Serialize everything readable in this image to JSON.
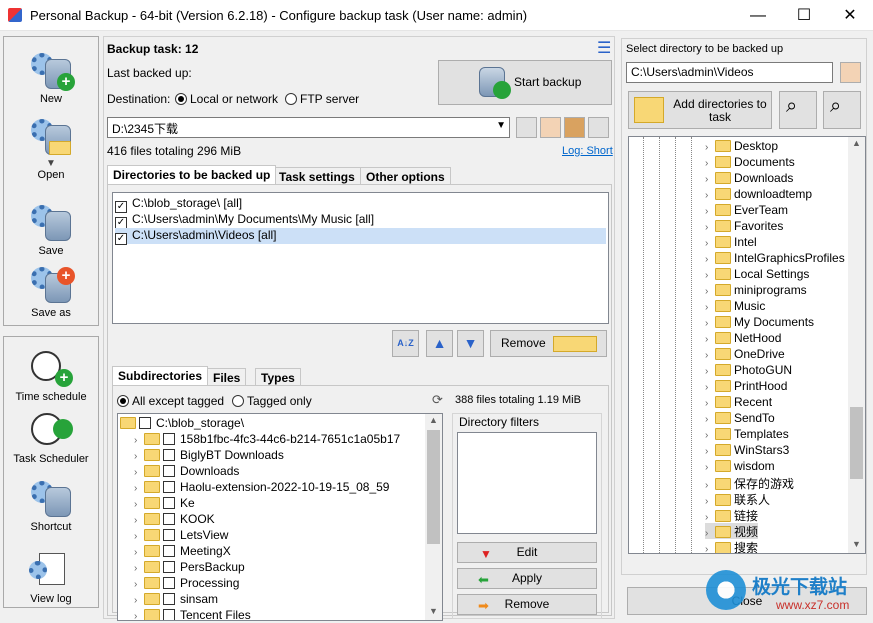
{
  "window": {
    "title": "Personal Backup - 64-bit (Version 6.2.18) - Configure backup task (User name: admin)",
    "minimize": "—",
    "maximize": "☐",
    "close": "✕"
  },
  "sidebar": {
    "top": [
      {
        "label": "New"
      },
      {
        "label": "Open"
      },
      {
        "label": "Save"
      },
      {
        "label": "Save as"
      }
    ],
    "bottom": [
      {
        "label": "Time schedule"
      },
      {
        "label": "Task Scheduler"
      },
      {
        "label": "Shortcut"
      },
      {
        "label": "View log"
      }
    ]
  },
  "task": {
    "title": "Backup task: 12",
    "last_backed_up_label": "Last backed up:",
    "destination_label": "Destination:",
    "dest_local": "Local or network",
    "dest_ftp": "FTP server",
    "destination_value": "D:\\2345下载",
    "summary": "416 files totaling 296 MiB",
    "log_link": "Log: Short",
    "start_button": "Start backup",
    "menu_icon": "☰"
  },
  "tabs": {
    "main": [
      "Directories to be backed up",
      "Task settings",
      "Other options"
    ]
  },
  "directories": [
    {
      "path": "C:\\blob_storage\\ [all]",
      "checked": true
    },
    {
      "path": "C:\\Users\\admin\\My Documents\\My Music [all]",
      "checked": true
    },
    {
      "path": "C:\\Users\\admin\\Videos [all]",
      "checked": true
    }
  ],
  "dir_actions": {
    "sort": "A↓Z",
    "remove": "Remove"
  },
  "subtabs": [
    "Subdirectories",
    "Files",
    "Types"
  ],
  "sub_options": {
    "all_except": "All except tagged",
    "tagged_only": "Tagged only",
    "summary": "388 files totaling 1.19 MiB"
  },
  "subdir_root": "C:\\blob_storage\\",
  "subdirs": [
    "158b1fbc-4fc3-44c6-b214-7651c1a05b17",
    "BiglyBT Downloads",
    "Downloads",
    "Haolu-extension-2022-10-19-15_08_59",
    "Ke",
    "KOOK",
    "LetsView",
    "MeetingX",
    "PersBackup",
    "Processing",
    "sinsam",
    "Tencent Files"
  ],
  "filters": {
    "title": "Directory filters",
    "edit": "Edit",
    "apply": "Apply",
    "remove": "Remove"
  },
  "right": {
    "title": "Select directory to be backed up",
    "path": "C:\\Users\\admin\\Videos",
    "add_button": "Add directories to task",
    "tree": [
      "Desktop",
      "Documents",
      "Downloads",
      "downloadtemp",
      "EverTeam",
      "Favorites",
      "Intel",
      "IntelGraphicsProfiles",
      "Local Settings",
      "miniprograms",
      "Music",
      "My Documents",
      "NetHood",
      "OneDrive",
      "PhotoGUN",
      "PrintHood",
      "Recent",
      "SendTo",
      "Templates",
      "WinStars3",
      "wisdom",
      "保存的游戏",
      "联系人",
      "链接",
      "视频",
      "搜索"
    ],
    "close": "Close"
  },
  "watermark": {
    "text": "极光下载站",
    "url": "www.xz7.com"
  }
}
